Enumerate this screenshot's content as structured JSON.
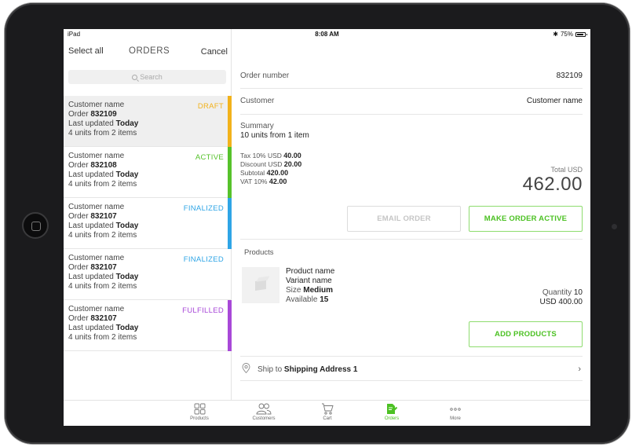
{
  "status_bar": {
    "device": "iPad",
    "time": "8:08 AM",
    "battery": "75%"
  },
  "left": {
    "select_all": "Select all",
    "title": "ORDERS",
    "cancel": "Cancel",
    "search_placeholder": "Search",
    "orders": [
      {
        "customer": "Customer name",
        "order_prefix": "Order ",
        "order_no": "832109",
        "updated_prefix": "Last updated ",
        "updated": "Today",
        "units": "4 units from 2 items",
        "status": "DRAFT",
        "color": "#f2b21b"
      },
      {
        "customer": "Customer name",
        "order_prefix": "Order ",
        "order_no": "832108",
        "updated_prefix": "Last updated ",
        "updated": "Today",
        "units": "4 units from 2 items",
        "status": "ACTIVE",
        "color": "#56c22b"
      },
      {
        "customer": "Customer name",
        "order_prefix": "Order ",
        "order_no": "832107",
        "updated_prefix": "Last updated ",
        "updated": "Today",
        "units": "4 units from 2 items",
        "status": "FINALIZED",
        "color": "#2fa5e6"
      },
      {
        "customer": "Customer name",
        "order_prefix": "Order ",
        "order_no": "832107",
        "updated_prefix": "Last updated ",
        "updated": "Today",
        "units": "4 units from 2 items",
        "status": "FINALIZED",
        "color": "#2fa5e6"
      },
      {
        "customer": "Customer name",
        "order_prefix": "Order ",
        "order_no": "832107",
        "updated_prefix": "Last updated ",
        "updated": "Today",
        "units": "4 units from 2 items",
        "status": "FULFILLED",
        "color": "#a848d8"
      }
    ]
  },
  "detail": {
    "order_number_label": "Order number",
    "order_number": "832109",
    "customer_label": "Customer",
    "customer": "Customer name",
    "summary_label": "Summary",
    "summary_units": "10 units from 1 item",
    "tax_label": "Tax 10% USD ",
    "tax": "40.00",
    "discount_label": "Discount USD ",
    "discount": "20.00",
    "subtotal_label": "Subtotal ",
    "subtotal": "420.00",
    "vat_label": "VAT 10% ",
    "vat": "42.00",
    "total_label": "Total USD",
    "total": "462.00",
    "email_button": "EMAIL ORDER",
    "active_button": "MAKE ORDER ACTIVE",
    "products_label": "Products",
    "product": {
      "name": "Product name",
      "variant": "Variant name",
      "size_label": "Size ",
      "size": "Medium",
      "available_label": "Available ",
      "available": "15",
      "quantity_label": "Quantity ",
      "quantity": "10",
      "price": "USD 400.00"
    },
    "add_products_button": "ADD PRODUCTS",
    "ship_prefix": "Ship to ",
    "ship_address": "Shipping Address 1"
  },
  "tabs": [
    {
      "label": "Products",
      "icon": "grid-icon"
    },
    {
      "label": "Customers",
      "icon": "users-icon"
    },
    {
      "label": "Cart",
      "icon": "cart-icon"
    },
    {
      "label": "Orders",
      "icon": "orders-icon",
      "active": true
    },
    {
      "label": "More",
      "icon": "more-icon"
    }
  ],
  "colors": {
    "accent_green": "#4cc123",
    "draft": "#f2b21b",
    "active": "#56c22b",
    "finalized": "#2fa5e6",
    "fulfilled": "#a848d8"
  }
}
